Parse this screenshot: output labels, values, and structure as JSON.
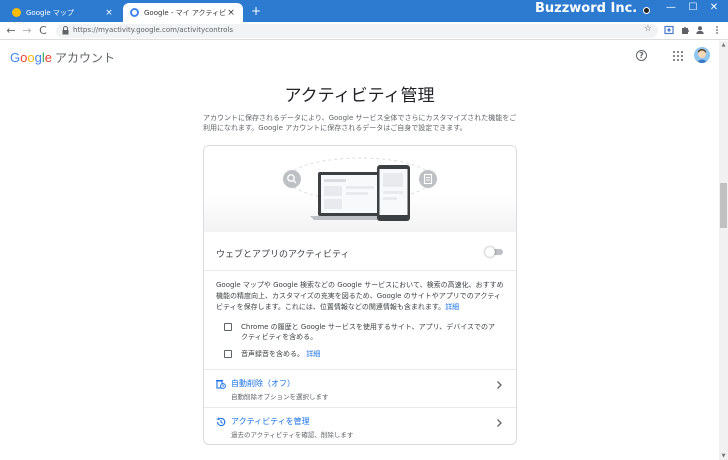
{
  "browser": {
    "tabs": [
      {
        "title": "Google マップ",
        "active": false,
        "favicon_color": "#fbbc04"
      },
      {
        "title": "Google - マイ アクティビティ",
        "active": true,
        "favicon_color": "#4285f4"
      }
    ],
    "new_tab_label": "+",
    "tab_close_glyph": "×",
    "brand_overlay": "Buzzword Inc.",
    "window_controls": {
      "minimize": "—",
      "maximize": "☐",
      "close": "✕"
    },
    "nav": {
      "back": "←",
      "forward": "→",
      "reload": "C"
    },
    "url": "https://myactivity.google.com/activitycontrols",
    "bookmark_star": "☆"
  },
  "header": {
    "logo_google": "Google",
    "logo_account": "アカウント",
    "help_glyph": "?"
  },
  "main": {
    "title": "アクティビティ管理",
    "intro": "アカウントに保存されるデータにより、Google サービス全体でさらにカスタマイズされた機能をご利用になれます。Google アカウントに保存されるデータはご自身で設定できます。"
  },
  "card": {
    "setting_title": "ウェブとアプリのアクティビティ",
    "toggle_on": false,
    "description": "Google マップや Google 検索などの Google サービスにおいて、検索の高速化、おすすめ機能の精度向上、カスタマイズの充実を図るため、Google のサイトやアプリでのアクティビティを保存します。これには、位置情報などの関連情報も含まれます。",
    "description_link": "詳細",
    "checkboxes": [
      {
        "label": "Chrome の履歴と Google サービスを使用するサイト、アプリ、デバイスでのアクティビティを含める。",
        "link": "",
        "checked": false
      },
      {
        "label": "音声録音を含める。",
        "link": "詳細",
        "checked": false
      }
    ],
    "links": [
      {
        "title": "自動削除（オフ）",
        "subtitle": "自動削除オプションを選択します",
        "icon": "auto-delete-icon"
      },
      {
        "title": "アクティビティを管理",
        "subtitle": "過去のアクティビティを確認、削除します",
        "icon": "history-icon"
      }
    ]
  },
  "colors": {
    "titlebar": "#2d7bd1",
    "link": "#1a73e8",
    "text": "#202124",
    "muted": "#5f6368"
  }
}
